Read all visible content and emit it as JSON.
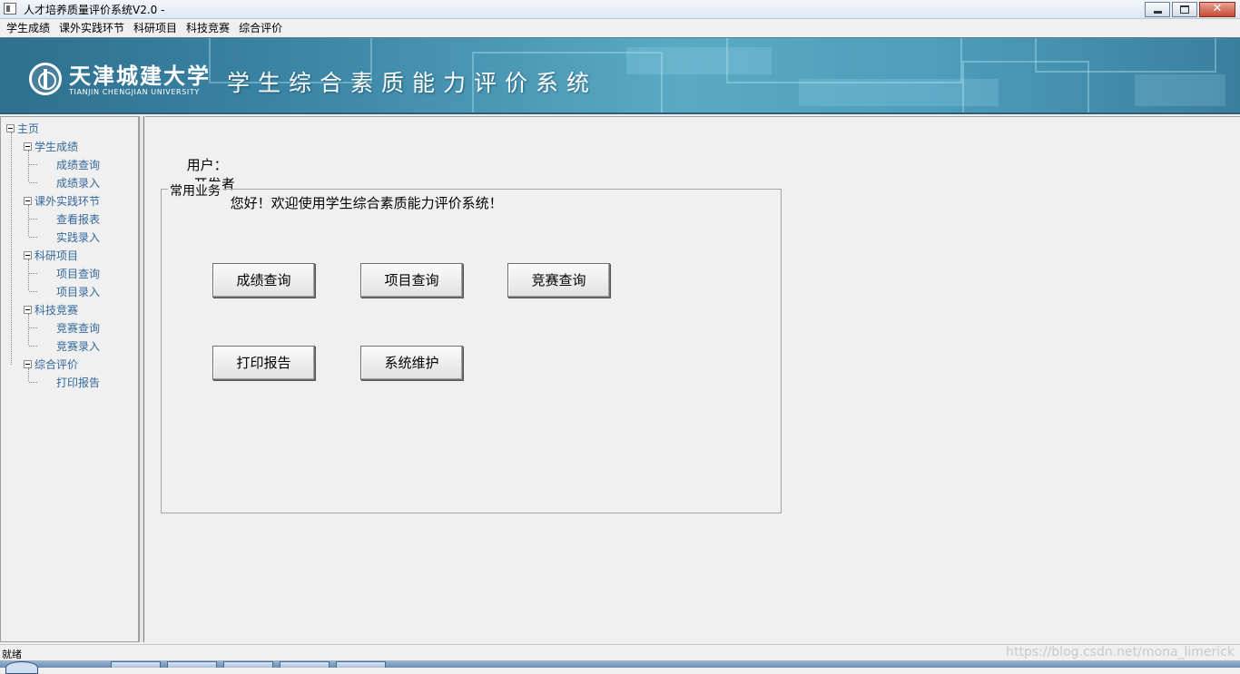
{
  "window": {
    "title": "人才培养质量评价系统V2.0 -"
  },
  "menu": [
    {
      "label": "学生成绩"
    },
    {
      "label": "课外实践环节"
    },
    {
      "label": "科研项目"
    },
    {
      "label": "科技竞赛"
    },
    {
      "label": "综合评价"
    }
  ],
  "banner": {
    "university_name": "天津城建大学",
    "university_name_en": "TIANJIN CHENGJIAN UNIVERSITY",
    "system_name": "学生综合素质能力评价系统"
  },
  "tree": {
    "root": "主页",
    "groups": [
      {
        "label": "学生成绩",
        "children": [
          "成绩查询",
          "成绩录入"
        ]
      },
      {
        "label": "课外实践环节",
        "children": [
          "查看报表",
          "实践录入"
        ]
      },
      {
        "label": "科研项目",
        "children": [
          "项目查询",
          "项目录入"
        ]
      },
      {
        "label": "科技竞赛",
        "children": [
          "竞赛查询",
          "竞赛录入"
        ]
      },
      {
        "label": "综合评价",
        "children": [
          "打印报告"
        ]
      }
    ]
  },
  "main": {
    "user_label": "用户：",
    "user_name": "开发者",
    "welcome": "您好！欢迎使用学生综合素质能力评价系统！",
    "group_title": "常用业务",
    "buttons": [
      "成绩查询",
      "项目查询",
      "竞赛查询",
      "打印报告",
      "系统维护"
    ]
  },
  "status": {
    "text": "就绪",
    "watermark": "https://blog.csdn.net/mona_limerick"
  },
  "colors": {
    "tree_text": "#34689a",
    "banner": "#3c86a6"
  }
}
